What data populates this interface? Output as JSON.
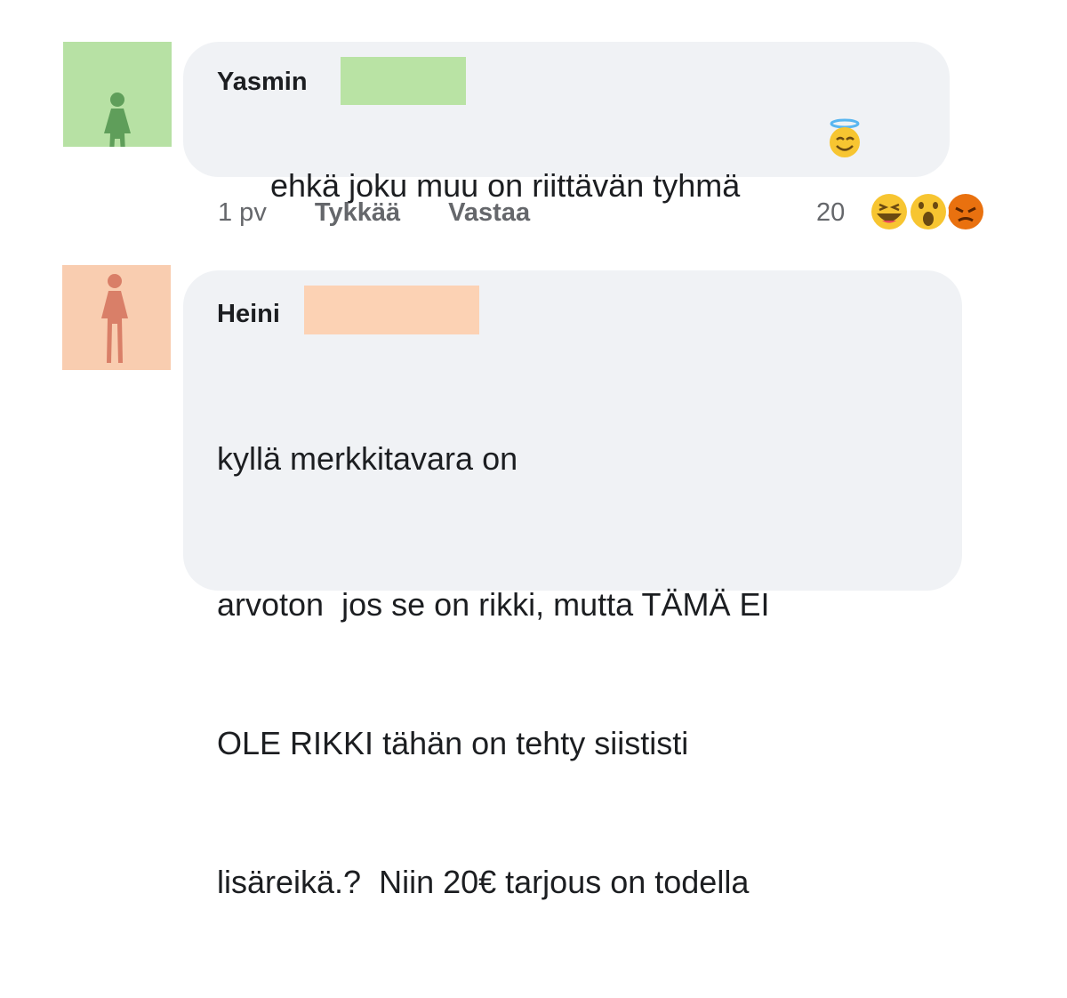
{
  "comments": [
    {
      "author": "Yasmin",
      "avatar_color": "#b7e1a4",
      "figure_color": "#5f9e5a",
      "redaction_color": "#b9e3a4",
      "text": "ehkä joku muu on riittävän tyhmä",
      "trailing_emoji_icon": "smiling-face-with-halo-icon",
      "time": "1 pv",
      "like_label": "Tykkää",
      "reply_label": "Vastaa",
      "reaction_count": "20",
      "reaction_icons": [
        "laughing-icon",
        "wow-icon",
        "angry-icon"
      ]
    },
    {
      "author": "Heini",
      "avatar_color": "#f9cdb0",
      "figure_color": "#d97f68",
      "redaction_color": "#fcd2b4",
      "text_lines": [
        "kyllä merkkitavara on",
        "arvoton  jos se on rikki, mutta TÄMÄ EI",
        "OLE RIKKI tähän on tehty siististi",
        "lisäreikä.?  Niin 20€ tarjous on todella"
      ]
    }
  ]
}
